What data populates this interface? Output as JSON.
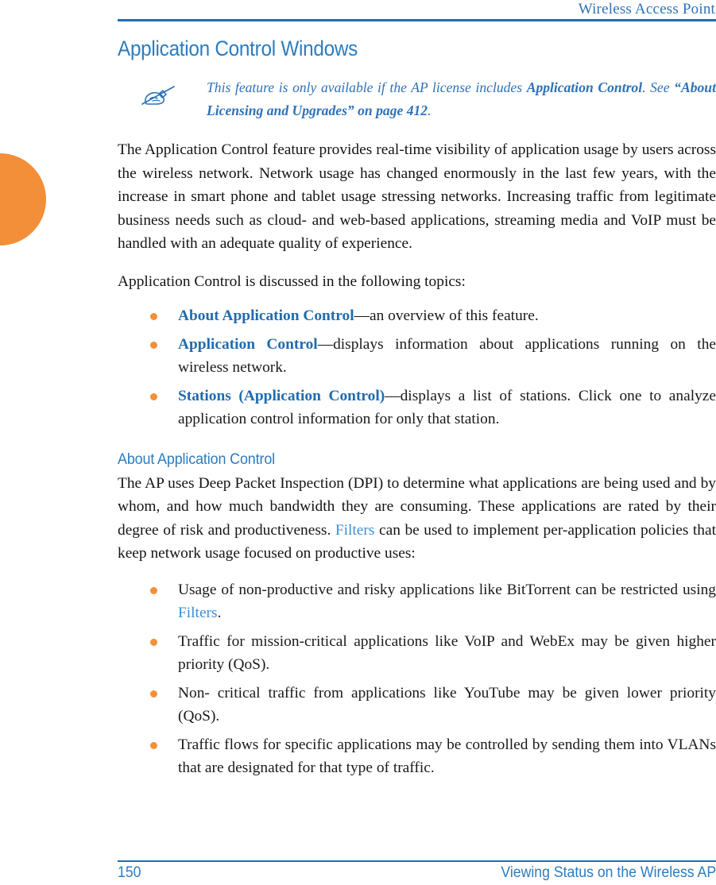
{
  "header": {
    "running_title": "Wireless Access Point",
    "rule_color": "#1f6cb0"
  },
  "colors": {
    "heading_blue": "#2b7cc0",
    "link_blue_bold": "#1f6cb0",
    "link_blue": "#3b8fd4",
    "bullet_orange": "#f2903a",
    "tab_orange": "#f28f38",
    "body_text": "#141414"
  },
  "page_title": "Application Control Windows",
  "note": {
    "icon": "note-pen-hand-icon",
    "text_plain": "This feature is only available if the AP license includes Application Control. See “About Licensing and Upgrades” on page 412.",
    "segments": [
      {
        "text": "This feature is only available if the AP license includes ",
        "bold": false
      },
      {
        "text": "Application Control",
        "bold": true
      },
      {
        "text": ". See ",
        "bold": false
      },
      {
        "text": "“About Licensing and Upgrades” on page 412",
        "bold": true
      },
      {
        "text": ".",
        "bold": false
      }
    ]
  },
  "intro_paragraph": "The Application Control feature provides real-time visibility of application usage by users across the wireless network. Network usage has changed enormously in the last few years, with the increase in smart phone and tablet usage stressing networks. Increasing traffic from legitimate business needs such as cloud- and web-based applications, streaming media and VoIP must be handled with an adequate quality of experience.",
  "topics_lead_in": "Application Control is discussed in the following topics:",
  "topics": [
    {
      "link": "About Application Control",
      "rest": "—an overview of this feature."
    },
    {
      "link": "Application Control",
      "rest": "—displays information about applications running on the wireless network."
    },
    {
      "link": "Stations (Application Control)",
      "rest": "—displays a list of stations. Click one to analyze application control information for only that station."
    }
  ],
  "section": {
    "heading": "About Application Control",
    "paragraph_segments": [
      {
        "text": "The AP uses Deep Packet Inspection (DPI) to determine what applications are being used and by whom, and how much bandwidth they are consuming. These applications are rated by their degree of risk and productiveness. ",
        "link": false
      },
      {
        "text": "Filters",
        "link": true
      },
      {
        "text": " can be used to implement per-application policies that keep network usage focused on productive uses:",
        "link": false
      }
    ],
    "paragraph_plain": "The AP uses Deep Packet Inspection (DPI) to determine what applications are being used and by whom, and how much bandwidth they are consuming. These applications are rated by their degree of risk and productiveness. Filters can be used to implement per-application policies that keep network usage focused on productive uses:",
    "bullets": [
      {
        "pre": "Usage of non-productive and risky applications like BitTorrent can be restricted using ",
        "link": "Filters",
        "post": "."
      },
      {
        "pre": "Traffic for mission-critical applications like VoIP and WebEx may be given higher priority (QoS).",
        "link": "",
        "post": ""
      },
      {
        "pre": "Non- critical traffic from applications like YouTube may be given lower priority (QoS).",
        "link": "",
        "post": ""
      },
      {
        "pre": "Traffic flows for specific applications may be controlled by sending them into VLANs that are designated for that type of traffic.",
        "link": "",
        "post": ""
      }
    ]
  },
  "footer": {
    "page_number": "150",
    "section_name": "Viewing Status on the Wireless AP"
  }
}
